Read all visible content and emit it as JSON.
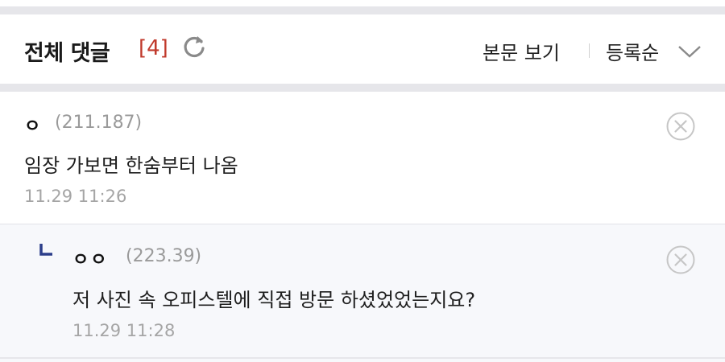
{
  "header": {
    "title": "전체 댓글",
    "count": "[4]",
    "refresh_icon": "refresh-icon",
    "view_body_label": "본문 보기",
    "sort_label": "등록순",
    "sort_icon": "chevron-down-icon"
  },
  "comments": [
    {
      "nickname": "ㅇ",
      "ip": "(211.187)",
      "text": "임장 가보면 한숨부터 나옴",
      "time": "11.29 11:26",
      "delete_icon": "delete-circle-icon"
    }
  ],
  "replies": [
    {
      "reply_icon": "reply-arrow-icon",
      "nickname": "ㅇㅇ",
      "ip": "(223.39)",
      "text": "저 사진 속 오피스텔에 직접 방문 하셨었었는지요?",
      "time": "11.29 11:28",
      "delete_icon": "delete-circle-icon"
    }
  ],
  "colors": {
    "count": "#c0392b",
    "meta_gray": "#9a9a9a",
    "divider": "#e6e6ea",
    "reply_bg": "#f7f8fb",
    "reply_marker": "#2c3e8a"
  }
}
